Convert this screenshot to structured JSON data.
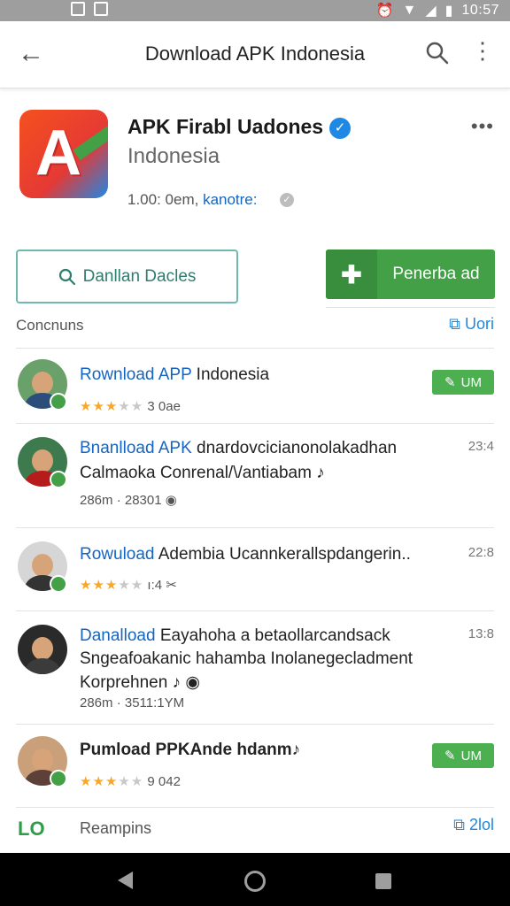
{
  "status_bar": {
    "time": "10:57"
  },
  "app_bar": {
    "back_icon": "arrow-back-icon",
    "title": "Download APK Indonesia",
    "search_icon": "search-icon",
    "more_icon": "more-vert-icon"
  },
  "app": {
    "name": "APK Firabl Uadones",
    "subtitle": "Indonesia",
    "meta_prefix": "1.00: 0em,",
    "meta_link": "kanotre:",
    "more": "•••"
  },
  "buttons": {
    "outline_label": "Danllan Dacles",
    "green_label": "Penerba ad"
  },
  "section": {
    "title": "Concnuns",
    "link": "Uori"
  },
  "items": [
    {
      "title_blue": "Rownload APP",
      "title_rest": " Indonesia",
      "line2": "",
      "stars_on": 3,
      "meta": "3 0ae",
      "side": "",
      "pill": "UM",
      "colors": {
        "bg": "#6aa06a",
        "shirt": "#2b4f7a"
      }
    },
    {
      "title_blue": "Bnanlload APK",
      "title_rest": " dnardovcicianonolakadhan",
      "line2": "Calmaoka Conrenal/\\/antiabam ♪",
      "stars_on": 0,
      "meta": "286m · 28301 ◉",
      "side": "23:4",
      "pill": "",
      "colors": {
        "bg": "#3d7a4e",
        "shirt": "#b71c1c"
      }
    },
    {
      "title_blue": "Rowuload",
      "title_rest": " Adembia Ucannkerallspdangerin..",
      "line2": "",
      "stars_on": 3,
      "meta": "ı:4 ✂",
      "side": "22:8",
      "pill": "",
      "colors": {
        "bg": "#d6d6d6",
        "shirt": "#333333"
      }
    },
    {
      "title_blue": "Danalload",
      "title_rest": " Eayahoha a betaollarcandsack",
      "line2": "Sngeafoakanic hahamba Inolanegecladment",
      "line3": "Korprehnen ♪ ◉",
      "stars_on": 0,
      "meta": "286m · 3511:1YM",
      "side": "13:8",
      "pill": "",
      "colors": {
        "bg": "#2a2a2a",
        "shirt": "#3b3b3b"
      }
    },
    {
      "title_blue": "",
      "title_rest": "Pumload PPKAnde hdanm♪",
      "line2": "",
      "stars_on": 3,
      "meta": "9 042",
      "side": "",
      "pill": "UM",
      "colors": {
        "bg": "#caa07a",
        "shirt": "#5d4037"
      }
    }
  ],
  "footer": {
    "logo": "LO",
    "text": "Reampins",
    "link": "2lol"
  }
}
